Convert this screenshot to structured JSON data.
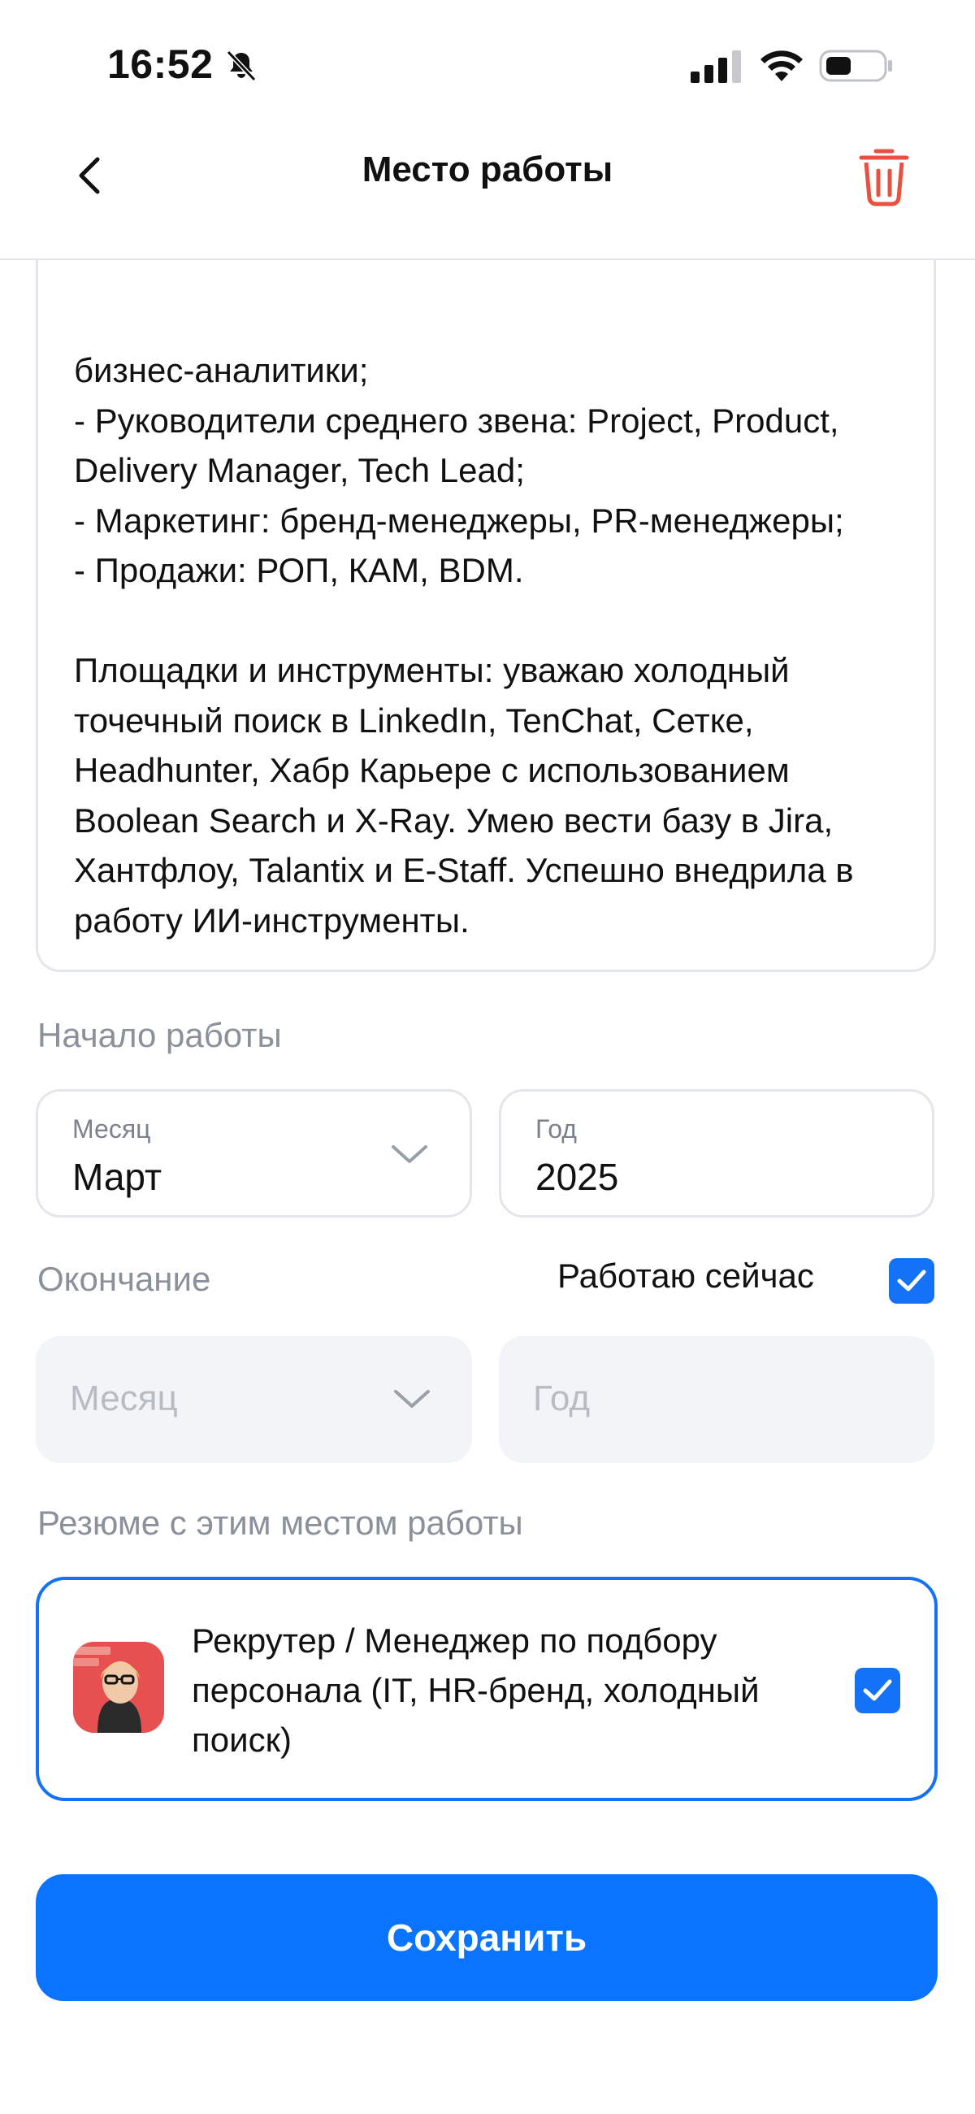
{
  "status_bar": {
    "time": "16:52",
    "icons": [
      "bell-slash-icon",
      "cellular-signal-icon",
      "wifi-icon",
      "battery-icon"
    ]
  },
  "nav": {
    "title": "Место работы",
    "back_icon": "chevron-left-icon",
    "delete_icon": "trash-icon"
  },
  "description": {
    "text": "бизнес-аналитики;\n- Руководители среднего звена: Project, Product, Delivery Manager, Tech Lead;\n- Маркетинг: бренд-менеджеры, PR-менеджеры;\n- Продажи: РОП, КАМ, BDM.\n\nПлощадки и инструменты: уважаю холодный точечный поиск в LinkedIn, TenChat, Сетке, Headhunter, Хабр Карьере с использованием Boolean Search и X-Ray. Умею вести базу в Jira, Хантфлоу, Talantix и E-Staff. Успешно внедрила в работу ИИ-инструменты."
  },
  "start": {
    "label": "Начало работы",
    "month_label": "Месяц",
    "month_value": "Март",
    "year_label": "Год",
    "year_value": "2025"
  },
  "end": {
    "label": "Окончание",
    "working_now_label": "Работаю сейчас",
    "working_now_checked": true,
    "month_placeholder": "Месяц",
    "year_placeholder": "Год"
  },
  "resume": {
    "label": "Резюме с этим местом работы",
    "title": "Рекрутер / Менеджер по подбору персонала (IT, HR-бренд, холодный поиск)",
    "checked": true
  },
  "actions": {
    "save_label": "Сохранить"
  },
  "colors": {
    "accent": "#0a74ff",
    "delete": "#e8513f",
    "muted": "#8a919b"
  }
}
